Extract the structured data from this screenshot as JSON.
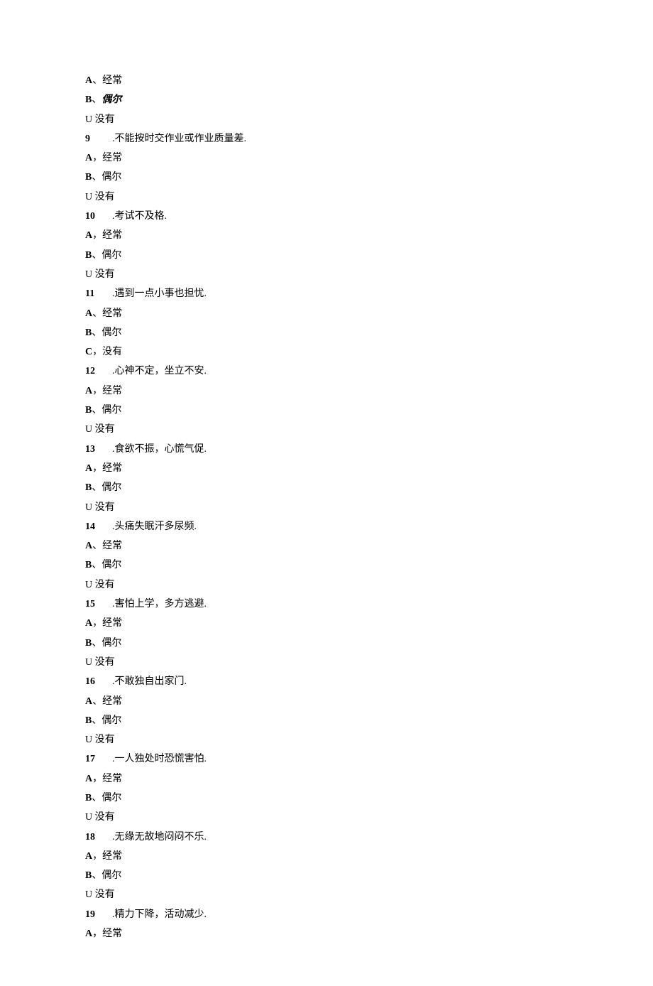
{
  "lines": [
    {
      "type": "opt",
      "letter": "A",
      "sep": "、",
      "text": "经常"
    },
    {
      "type": "optital",
      "letter": "B",
      "sep": "、",
      "text": "偶尔"
    },
    {
      "type": "u",
      "text": "U 没有"
    },
    {
      "type": "q",
      "num": "9",
      "text": ".不能按时交作业或作业质量差."
    },
    {
      "type": "opt",
      "letter": "A",
      "sep": "，",
      "text": "经常"
    },
    {
      "type": "opt",
      "letter": "B",
      "sep": "、",
      "text": "偶尔"
    },
    {
      "type": "u",
      "text": "U 没有"
    },
    {
      "type": "q",
      "num": "10",
      "text": ".考试不及格."
    },
    {
      "type": "opt",
      "letter": "A",
      "sep": "，",
      "text": "经常"
    },
    {
      "type": "opt",
      "letter": "B",
      "sep": "、",
      "text": "偶尔"
    },
    {
      "type": "u",
      "text": "U 没有"
    },
    {
      "type": "q",
      "num": "11",
      "text": ".遇到一点小事也担忧."
    },
    {
      "type": "opt",
      "letter": "A",
      "sep": "、",
      "text": "经常"
    },
    {
      "type": "opt",
      "letter": "B",
      "sep": "、",
      "text": "偶尔"
    },
    {
      "type": "opt",
      "letter": "C",
      "sep": "，",
      "text": "没有"
    },
    {
      "type": "q",
      "num": "12",
      "text": ".心神不定，坐立不安."
    },
    {
      "type": "opt",
      "letter": "A",
      "sep": "，",
      "text": "经常"
    },
    {
      "type": "opt",
      "letter": "B",
      "sep": "、",
      "text": "偶尔"
    },
    {
      "type": "u",
      "text": "U 没有"
    },
    {
      "type": "q",
      "num": "13",
      "text": ".食欲不振，心慌气促."
    },
    {
      "type": "opt",
      "letter": "A",
      "sep": "，",
      "text": "经常"
    },
    {
      "type": "opt",
      "letter": "B",
      "sep": "、",
      "text": "偶尔"
    },
    {
      "type": "u",
      "text": "U 没有"
    },
    {
      "type": "q",
      "num": "14",
      "text": ".头痛失眠汗多尿频."
    },
    {
      "type": "opt",
      "letter": "A",
      "sep": "、",
      "text": "经常"
    },
    {
      "type": "opt",
      "letter": "B",
      "sep": "、",
      "text": "偶尔"
    },
    {
      "type": "u",
      "text": "U 没有"
    },
    {
      "type": "q",
      "num": "15",
      "text": ".害怕上学，多方逃避."
    },
    {
      "type": "opt",
      "letter": "A",
      "sep": "，",
      "text": "经常"
    },
    {
      "type": "opt",
      "letter": "B",
      "sep": "、",
      "text": "偶尔"
    },
    {
      "type": "u",
      "text": "U 没有"
    },
    {
      "type": "q",
      "num": "16",
      "text": ".不敢独自出家门."
    },
    {
      "type": "opt",
      "letter": "A",
      "sep": "、",
      "text": "经常"
    },
    {
      "type": "opt",
      "letter": "B",
      "sep": "、",
      "text": "偶尔"
    },
    {
      "type": "u",
      "text": "U 没有"
    },
    {
      "type": "q",
      "num": "17",
      "text": ".一人独处时恐慌害怕."
    },
    {
      "type": "opt",
      "letter": "A",
      "sep": "，",
      "text": "经常"
    },
    {
      "type": "opt",
      "letter": "B",
      "sep": "、",
      "text": "偶尔"
    },
    {
      "type": "u",
      "text": "U 没有"
    },
    {
      "type": "q",
      "num": "18",
      "text": ".无缘无故地闷闷不乐."
    },
    {
      "type": "opt",
      "letter": "A",
      "sep": "，",
      "text": "经常"
    },
    {
      "type": "opt",
      "letter": "B",
      "sep": "、",
      "text": "偶尔"
    },
    {
      "type": "u",
      "text": "U 没有"
    },
    {
      "type": "q",
      "num": "19",
      "text": ".精力下降，活动减少."
    },
    {
      "type": "opt",
      "letter": "A",
      "sep": "，",
      "text": "经常"
    }
  ]
}
